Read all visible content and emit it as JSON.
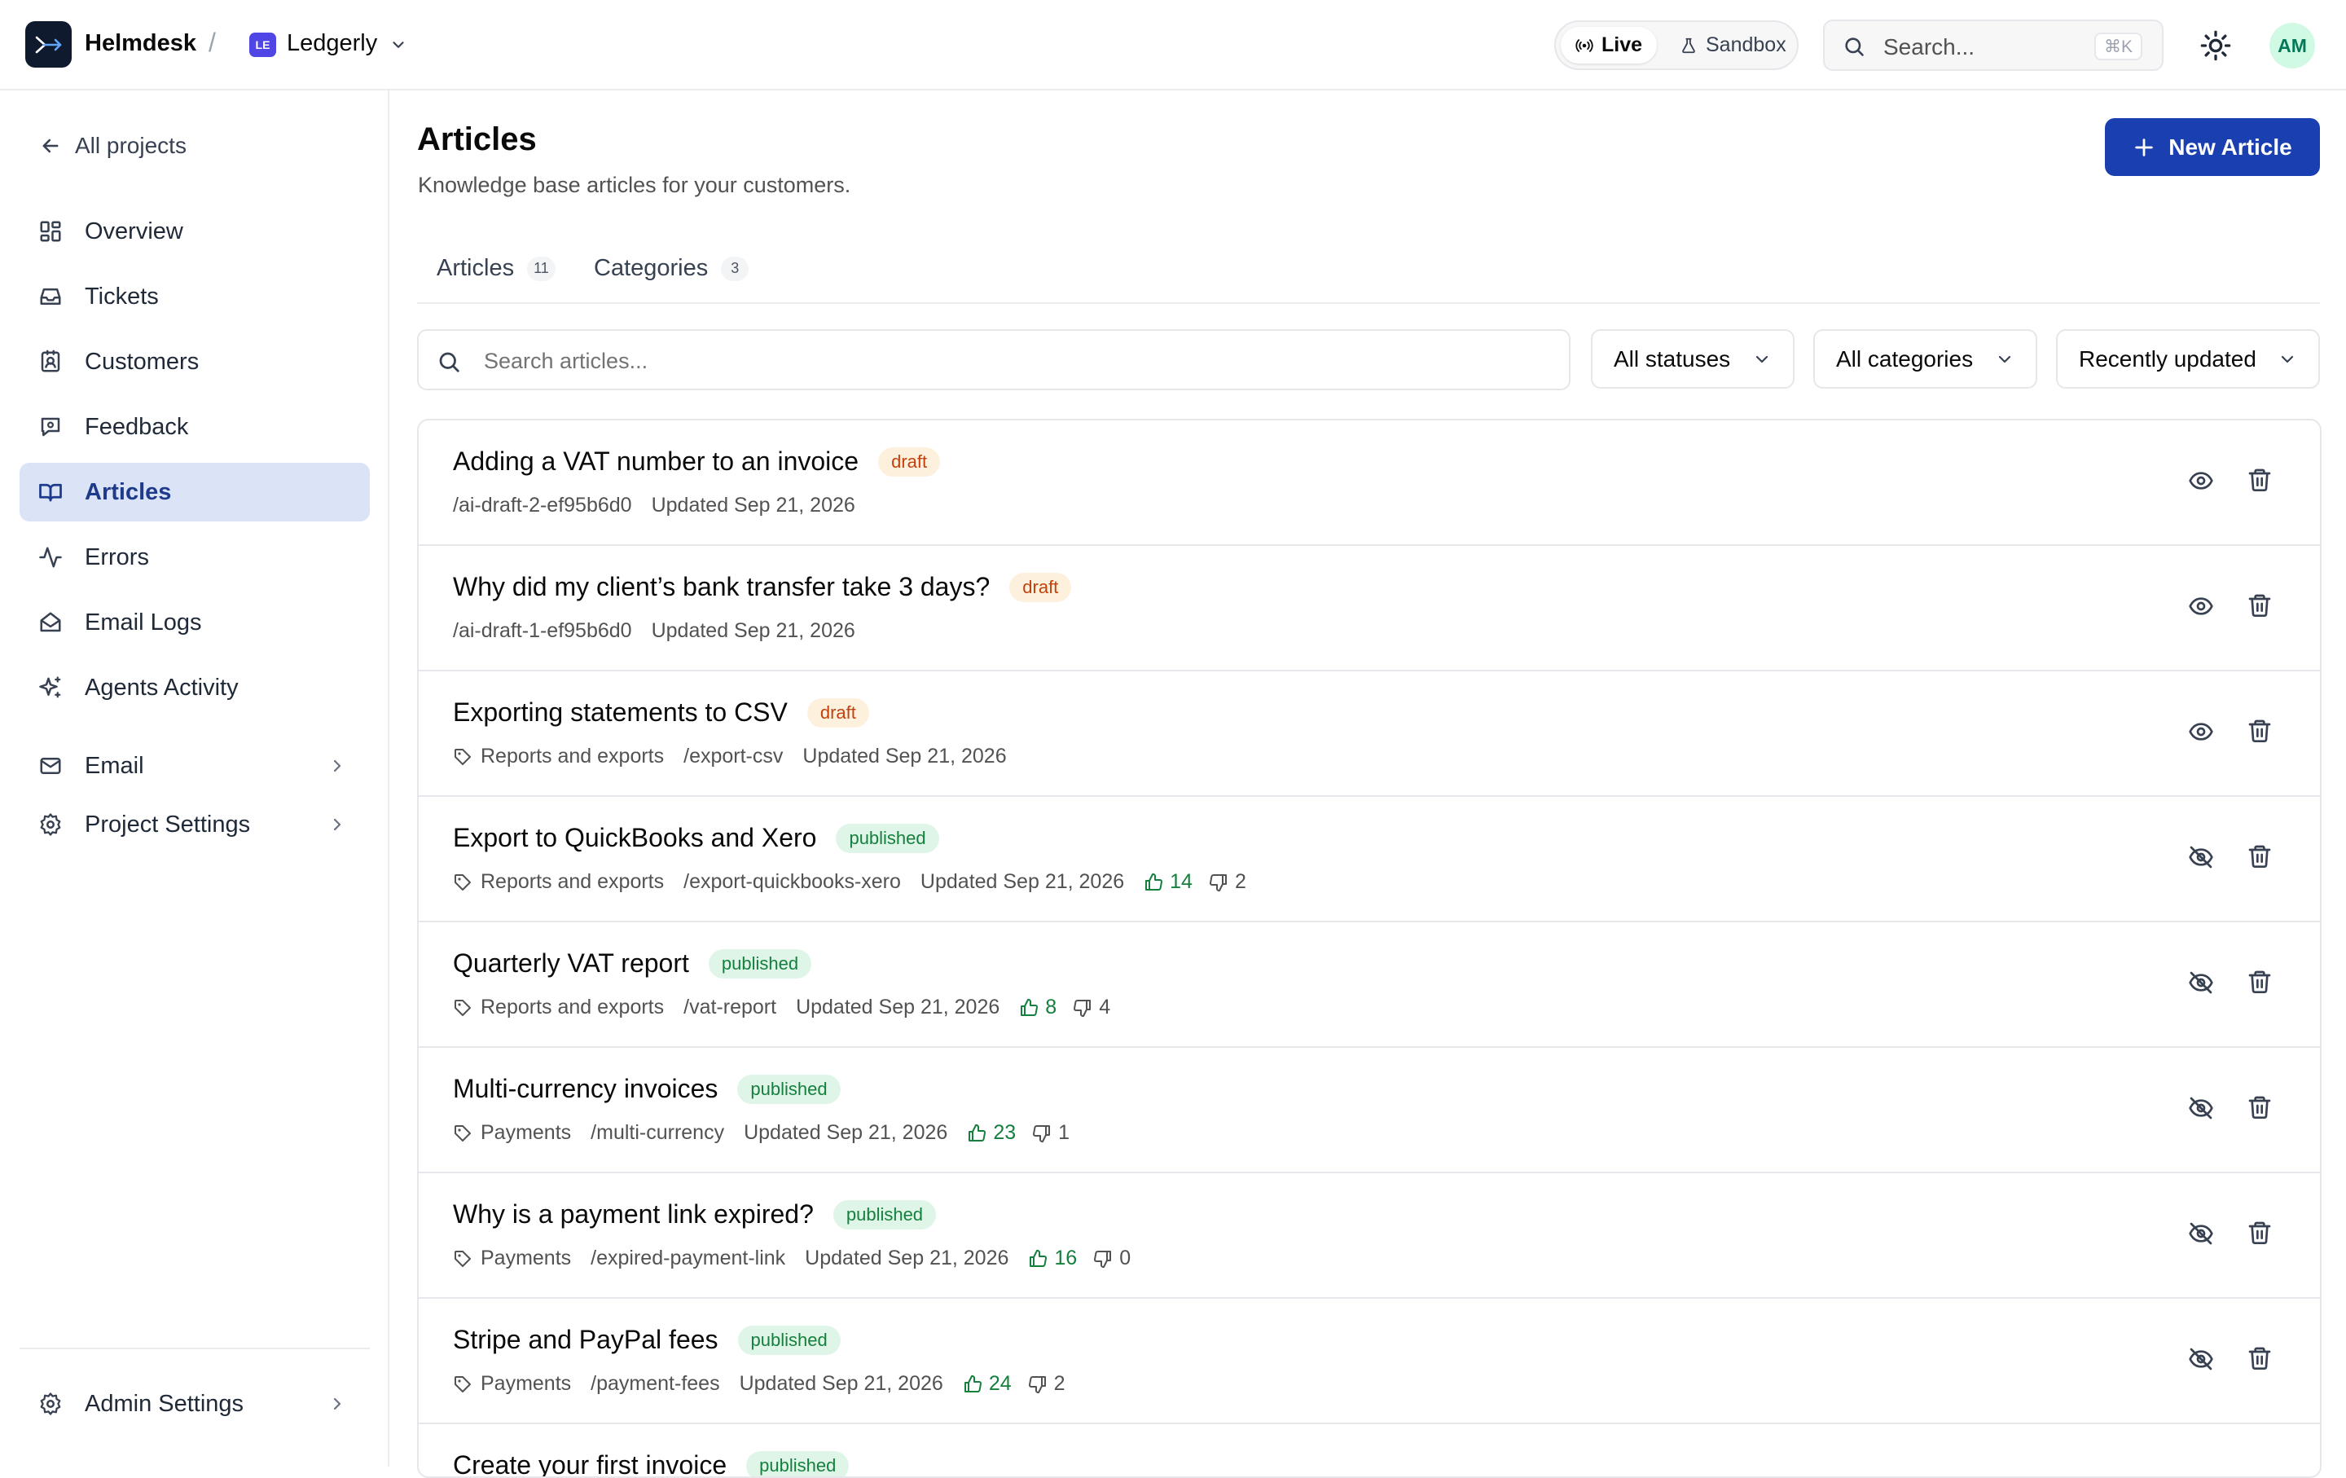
{
  "header": {
    "brand": "Helmdesk",
    "separator": "/",
    "project_badge": "LE",
    "project_name": "Ledgerly",
    "env_live": "Live",
    "env_sandbox": "Sandbox",
    "search_placeholder": "Search...",
    "search_shortcut": "⌘K",
    "avatar_initials": "AM"
  },
  "sidebar": {
    "back_label": "All projects",
    "items": [
      {
        "label": "Overview",
        "icon": "grid-icon"
      },
      {
        "label": "Tickets",
        "icon": "inbox-icon"
      },
      {
        "label": "Customers",
        "icon": "contact-card-icon"
      },
      {
        "label": "Feedback",
        "icon": "message-square-icon"
      },
      {
        "label": "Articles",
        "icon": "book-open-icon",
        "active": true
      },
      {
        "label": "Errors",
        "icon": "activity-icon"
      },
      {
        "label": "Email Logs",
        "icon": "mail-open-icon"
      },
      {
        "label": "Agents Activity",
        "icon": "sparkles-icon"
      },
      {
        "label": "Email",
        "icon": "mail-icon",
        "expandable": true
      },
      {
        "label": "Project Settings",
        "icon": "gear-icon",
        "expandable": true
      }
    ],
    "admin_label": "Admin Settings"
  },
  "main": {
    "title": "Articles",
    "subtitle": "Knowledge base articles for your customers.",
    "new_button": "New Article",
    "tabs": [
      {
        "label": "Articles",
        "count": "11",
        "active": true
      },
      {
        "label": "Categories",
        "count": "3",
        "active": false
      }
    ],
    "search_placeholder": "Search articles...",
    "filters": {
      "status": "All statuses",
      "category": "All categories",
      "sort": "Recently updated"
    }
  },
  "articles": [
    {
      "title": "Adding a VAT number to an invoice",
      "status": "draft",
      "category": "",
      "slug": "/ai-draft-2-ef95b6d0",
      "updated": "Updated Sep 21, 2026",
      "up": "",
      "down": ""
    },
    {
      "title": "Why did my client’s bank transfer take 3 days?",
      "status": "draft",
      "category": "",
      "slug": "/ai-draft-1-ef95b6d0",
      "updated": "Updated Sep 21, 2026",
      "up": "",
      "down": ""
    },
    {
      "title": "Exporting statements to CSV",
      "status": "draft",
      "category": "Reports and exports",
      "slug": "/export-csv",
      "updated": "Updated Sep 21, 2026",
      "up": "",
      "down": ""
    },
    {
      "title": "Export to QuickBooks and Xero",
      "status": "published",
      "category": "Reports and exports",
      "slug": "/export-quickbooks-xero",
      "updated": "Updated Sep 21, 2026",
      "up": "14",
      "down": "2"
    },
    {
      "title": "Quarterly VAT report",
      "status": "published",
      "category": "Reports and exports",
      "slug": "/vat-report",
      "updated": "Updated Sep 21, 2026",
      "up": "8",
      "down": "4"
    },
    {
      "title": "Multi-currency invoices",
      "status": "published",
      "category": "Payments",
      "slug": "/multi-currency",
      "updated": "Updated Sep 21, 2026",
      "up": "23",
      "down": "1"
    },
    {
      "title": "Why is a payment link expired?",
      "status": "published",
      "category": "Payments",
      "slug": "/expired-payment-link",
      "updated": "Updated Sep 21, 2026",
      "up": "16",
      "down": "0"
    },
    {
      "title": "Stripe and PayPal fees",
      "status": "published",
      "category": "Payments",
      "slug": "/payment-fees",
      "updated": "Updated Sep 21, 2026",
      "up": "24",
      "down": "2"
    },
    {
      "title": "Create your first invoice",
      "status": "published",
      "category": "",
      "slug": "",
      "updated": "",
      "up": "",
      "down": ""
    }
  ],
  "colors": {
    "accent": "#1a3fb0",
    "active_nav_bg": "#dbe4f6",
    "draft_bg": "#fdf1de",
    "draft_text": "#c2410c",
    "published_bg": "#dff5e8",
    "published_text": "#15803d"
  }
}
